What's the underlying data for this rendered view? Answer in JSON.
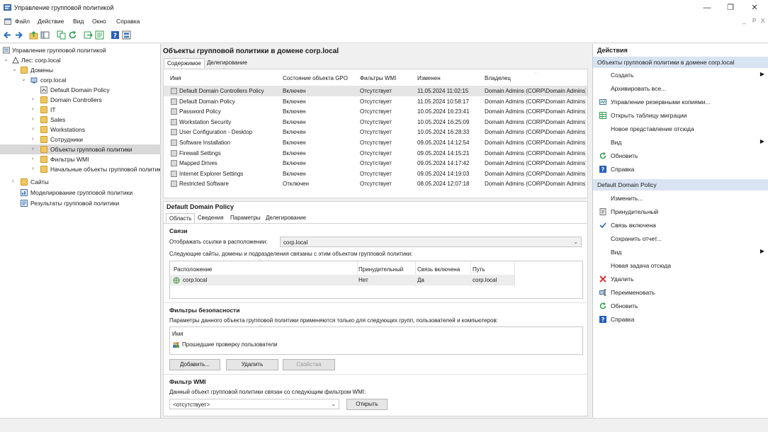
{
  "window": {
    "title": "Управление групповой политикой",
    "controls": [
      "—",
      "❐",
      "✕"
    ]
  },
  "menu": [
    "Файл",
    "Действие",
    "Вид",
    "Окно",
    "Справка"
  ],
  "mdi_controls": [
    "_",
    "P",
    "X"
  ],
  "tree": {
    "root": "Управление групповой политикой",
    "forest": "Лес: corp.local",
    "domains": "Домены",
    "domain": "corp.local",
    "domain_children": [
      "Default Domain Policy",
      "Domain Controllers",
      "IT",
      "Sales",
      "Workstations",
      "Сотрудники",
      "Объекты групповой политики",
      "Фильтры WMI",
      "Начальные объекты групповой политики"
    ],
    "sites": "Сайты",
    "modeling": "Моделирование групповой политики",
    "results": "Результаты групповой политики"
  },
  "gpo_list": {
    "title": "Объекты групповой политики в домене corp.local",
    "tabs": [
      "Содержимое",
      "Делегирование"
    ],
    "columns": [
      "Имя",
      "Состояние объекта GPO",
      "Фильтры WMI",
      "Изменен",
      "Владелец"
    ],
    "rows": [
      {
        "name": "Default Domain Controllers Policy",
        "status": "Включен",
        "wmi": "Отсутствует",
        "modified": "11.05.2024 11:02:15",
        "owner": "Domain Admins (CORP\\Domain Admins)"
      },
      {
        "name": "Default Domain Policy",
        "status": "Включен",
        "wmi": "Отсутствует",
        "modified": "11.05.2024 10:58:17",
        "owner": "Domain Admins (CORP\\Domain Admins)"
      },
      {
        "name": "Password Policy",
        "status": "Включен",
        "wmi": "Отсутствует",
        "modified": "10.05.2024 16:23:41",
        "owner": "Domain Admins (CORP\\Domain Admins)"
      },
      {
        "name": "Workstation Security",
        "status": "Включен",
        "wmi": "Отсутствует",
        "modified": "10.05.2024 16:25:09",
        "owner": "Domain Admins (CORP\\Domain Admins)"
      },
      {
        "name": "User Configuration - Desktop",
        "status": "Включен",
        "wmi": "Отсутствует",
        "modified": "10.05.2024 16:28:33",
        "owner": "Domain Admins (CORP\\Domain Admins)"
      },
      {
        "name": "Software Installation",
        "status": "Включен",
        "wmi": "Отсутствует",
        "modified": "09.05.2024 14:12:54",
        "owner": "Domain Admins (CORP\\Domain Admins)"
      },
      {
        "name": "Firewall Settings",
        "status": "Включен",
        "wmi": "Отсутствует",
        "modified": "09.05.2024 14:15:21",
        "owner": "Domain Admins (CORP\\Domain Admins)"
      },
      {
        "name": "Mapped Drives",
        "status": "Включен",
        "wmi": "Отсутствует",
        "modified": "09.05.2024 14:17:42",
        "owner": "Domain Admins (CORP\\Domain Admins)"
      },
      {
        "name": "Internet Explorer Settings",
        "status": "Включен",
        "wmi": "Отсутствует",
        "modified": "09.05.2024 14:19:03",
        "owner": "Domain Admins (CORP\\Domain Admins)"
      },
      {
        "name": "Restricted Software",
        "status": "Отключен",
        "wmi": "Отсутствует",
        "modified": "08.05.2024 12:07:18",
        "owner": "Domain Admins (CORP\\Domain Admins)"
      }
    ]
  },
  "details": {
    "title": "Default Domain Policy",
    "tabs": [
      "Область",
      "Сведения",
      "Параметры",
      "Делегирование"
    ],
    "links": {
      "heading": "Связи",
      "location_label": "Отображать ссылки в расположении:",
      "location_value": "corp.local",
      "description": "Следующие сайты, домены и подразделения связаны с этим объектом групповой политики:",
      "columns": [
        "Расположение",
        "Принудительный",
        "Связь включена",
        "Путь"
      ],
      "row": {
        "location": "corp.local",
        "enforced": "Нет",
        "enabled": "Да",
        "path": "corp.local"
      }
    },
    "security": {
      "heading": "Фильтры безопасности",
      "description": "Параметры данного объекта групповой политики применяются только для следующих групп, пользователей и компьютеров:",
      "column": "Имя",
      "entry": "Прошедшие проверку пользователи",
      "add": "Добавить...",
      "remove": "Удалить",
      "properties": "Свойства"
    },
    "wmi": {
      "heading": "Фильтр WMI",
      "description": "Данный объект групповой политики связан со следующим фильтром WMI:",
      "value": "<отсутствует>",
      "open": "Открыть"
    }
  },
  "actions": {
    "title": "Действия",
    "section1": "Объекты групповой политики в домене corp.local",
    "items1": [
      "Создать",
      "Архивировать все...",
      "Управление резервными копиями...",
      "Открыть таблицу миграции",
      "Новое представление отсюда",
      "Вид",
      "Обновить",
      "Справка"
    ],
    "section2": "Default Domain Policy",
    "items2": [
      "Изменить...",
      "Принудительный",
      "Связь включена",
      "Сохранить отчет...",
      "Вид",
      "Новая задача отсюда",
      "Удалить",
      "Переименовать",
      "Обновить",
      "Справка"
    ]
  },
  "colors": {
    "accent": "#d9e4f2",
    "selection": "#d9d9d9",
    "folder": "#f1c75c",
    "delete": "#d03a3a",
    "help": "#2a5fb8",
    "refresh": "#2e9b4e"
  }
}
